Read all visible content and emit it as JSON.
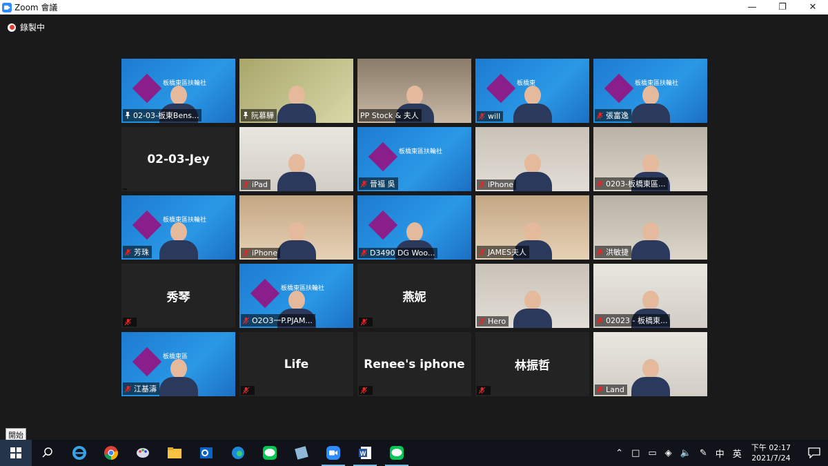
{
  "window": {
    "title": "Zoom 會議"
  },
  "recording": {
    "label": "錄製中"
  },
  "tiles": [
    {
      "name": "02-03-板東Bens...",
      "pinned": true,
      "muted": false,
      "bg": "blue",
      "video": true,
      "text": "板橋東區扶輪社"
    },
    {
      "name": "阮慕驊",
      "pinned": true,
      "muted": false,
      "bg": "wall",
      "video": true,
      "text": ""
    },
    {
      "name": "PP Stock & 夫人",
      "pinned": false,
      "muted": false,
      "bg": "room",
      "video": true,
      "text": "",
      "active": true
    },
    {
      "name": "will",
      "pinned": false,
      "muted": true,
      "bg": "blue",
      "video": true,
      "text": "板橋東"
    },
    {
      "name": "張富逸",
      "pinned": false,
      "muted": true,
      "bg": "blue",
      "video": true,
      "text": "板橋東區扶輪社"
    },
    {
      "name": "02-03-Jey",
      "pinned": false,
      "muted": false,
      "bg": "dark",
      "video": false,
      "text": ""
    },
    {
      "name": "iPad",
      "pinned": false,
      "muted": true,
      "bg": "light",
      "video": true,
      "text": ""
    },
    {
      "name": "晉福 吳",
      "pinned": false,
      "muted": true,
      "bg": "blue",
      "video": false,
      "text": "板橋東區扶輪社"
    },
    {
      "name": "iPhone",
      "pinned": false,
      "muted": true,
      "bg": "pale",
      "video": true,
      "text": ""
    },
    {
      "name": "0203-板橋東區...",
      "pinned": false,
      "muted": true,
      "bg": "home",
      "video": true,
      "text": ""
    },
    {
      "name": "芳珠",
      "pinned": false,
      "muted": true,
      "bg": "blue",
      "video": true,
      "text": "板橋東區扶輪社"
    },
    {
      "name": "iPhone",
      "pinned": false,
      "muted": true,
      "bg": "warm",
      "video": true,
      "text": ""
    },
    {
      "name": "D3490 DG  Woo...",
      "pinned": false,
      "muted": true,
      "bg": "blue",
      "video": true,
      "text": ""
    },
    {
      "name": "JAMES夫人",
      "pinned": false,
      "muted": true,
      "bg": "warm",
      "video": true,
      "text": ""
    },
    {
      "name": "洪敏捷",
      "pinned": false,
      "muted": true,
      "bg": "home",
      "video": true,
      "text": ""
    },
    {
      "name": "秀琴",
      "pinned": false,
      "muted": true,
      "bg": "dark",
      "video": false,
      "text": ""
    },
    {
      "name": "O2O3一P.PJAM...",
      "pinned": false,
      "muted": true,
      "bg": "blue",
      "video": true,
      "text": "板橋東區扶輪社"
    },
    {
      "name": "燕妮",
      "pinned": false,
      "muted": true,
      "bg": "dark",
      "video": false,
      "text": ""
    },
    {
      "name": "Hero",
      "pinned": false,
      "muted": true,
      "bg": "pale",
      "video": true,
      "text": ""
    },
    {
      "name": "02023 - 板橋東...",
      "pinned": false,
      "muted": true,
      "bg": "light",
      "video": true,
      "text": ""
    },
    {
      "name": "江基濤",
      "pinned": false,
      "muted": true,
      "bg": "blue",
      "video": true,
      "text": "板橋東區"
    },
    {
      "name": "Life",
      "pinned": false,
      "muted": true,
      "bg": "dark",
      "video": false,
      "text": ""
    },
    {
      "name": "Renee's iphone",
      "pinned": false,
      "muted": true,
      "bg": "dark",
      "video": false,
      "text": ""
    },
    {
      "name": "林振哲",
      "pinned": false,
      "muted": true,
      "bg": "dark",
      "video": false,
      "text": ""
    },
    {
      "name": "Land",
      "pinned": false,
      "muted": true,
      "bg": "light",
      "video": true,
      "text": ""
    }
  ],
  "taskbar": {
    "start_tooltip": "開始",
    "ime": "中",
    "ime2": "英",
    "time": "下午 02:17",
    "date": "2021/7/24"
  },
  "colors": {
    "active_speaker": "#b5e335",
    "zoom_blue": "#2d8cff",
    "banner_purple": "#8a1e8a"
  }
}
